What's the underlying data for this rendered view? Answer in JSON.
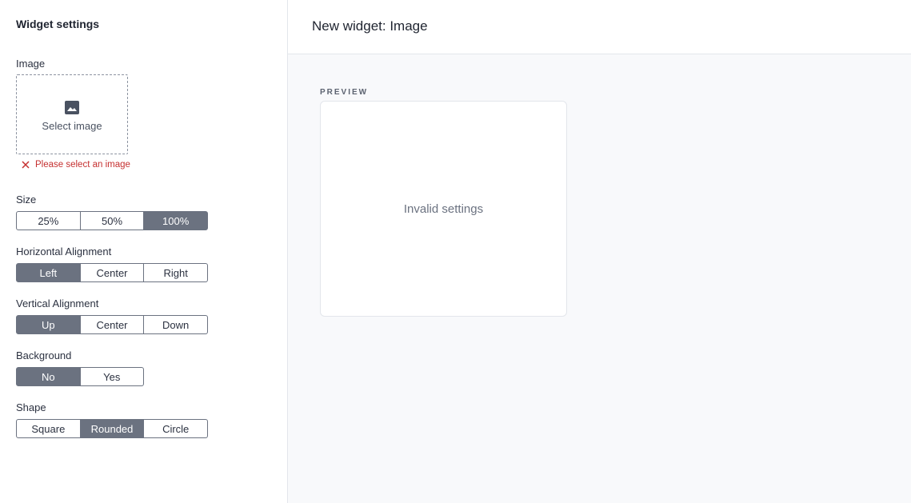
{
  "sidebar": {
    "title": "Widget settings",
    "image": {
      "label": "Image",
      "select_text": "Select image",
      "icon": "image-icon",
      "error": "Please select an image"
    },
    "size": {
      "label": "Size",
      "options": [
        "25%",
        "50%",
        "100%"
      ],
      "selected": "100%"
    },
    "horizontal_alignment": {
      "label": "Horizontal Alignment",
      "options": [
        "Left",
        "Center",
        "Right"
      ],
      "selected": "Left"
    },
    "vertical_alignment": {
      "label": "Vertical Alignment",
      "options": [
        "Up",
        "Center",
        "Down"
      ],
      "selected": "Up"
    },
    "background": {
      "label": "Background",
      "options": [
        "No",
        "Yes"
      ],
      "selected": "No"
    },
    "shape": {
      "label": "Shape",
      "options": [
        "Square",
        "Rounded",
        "Circle"
      ],
      "selected": "Rounded"
    }
  },
  "main": {
    "title": "New widget: Image",
    "preview_label": "PREVIEW",
    "preview_message": "Invalid settings"
  },
  "colors": {
    "active_segment": "#6b7280",
    "error": "#c53030",
    "main_background": "#f8f9fb"
  }
}
